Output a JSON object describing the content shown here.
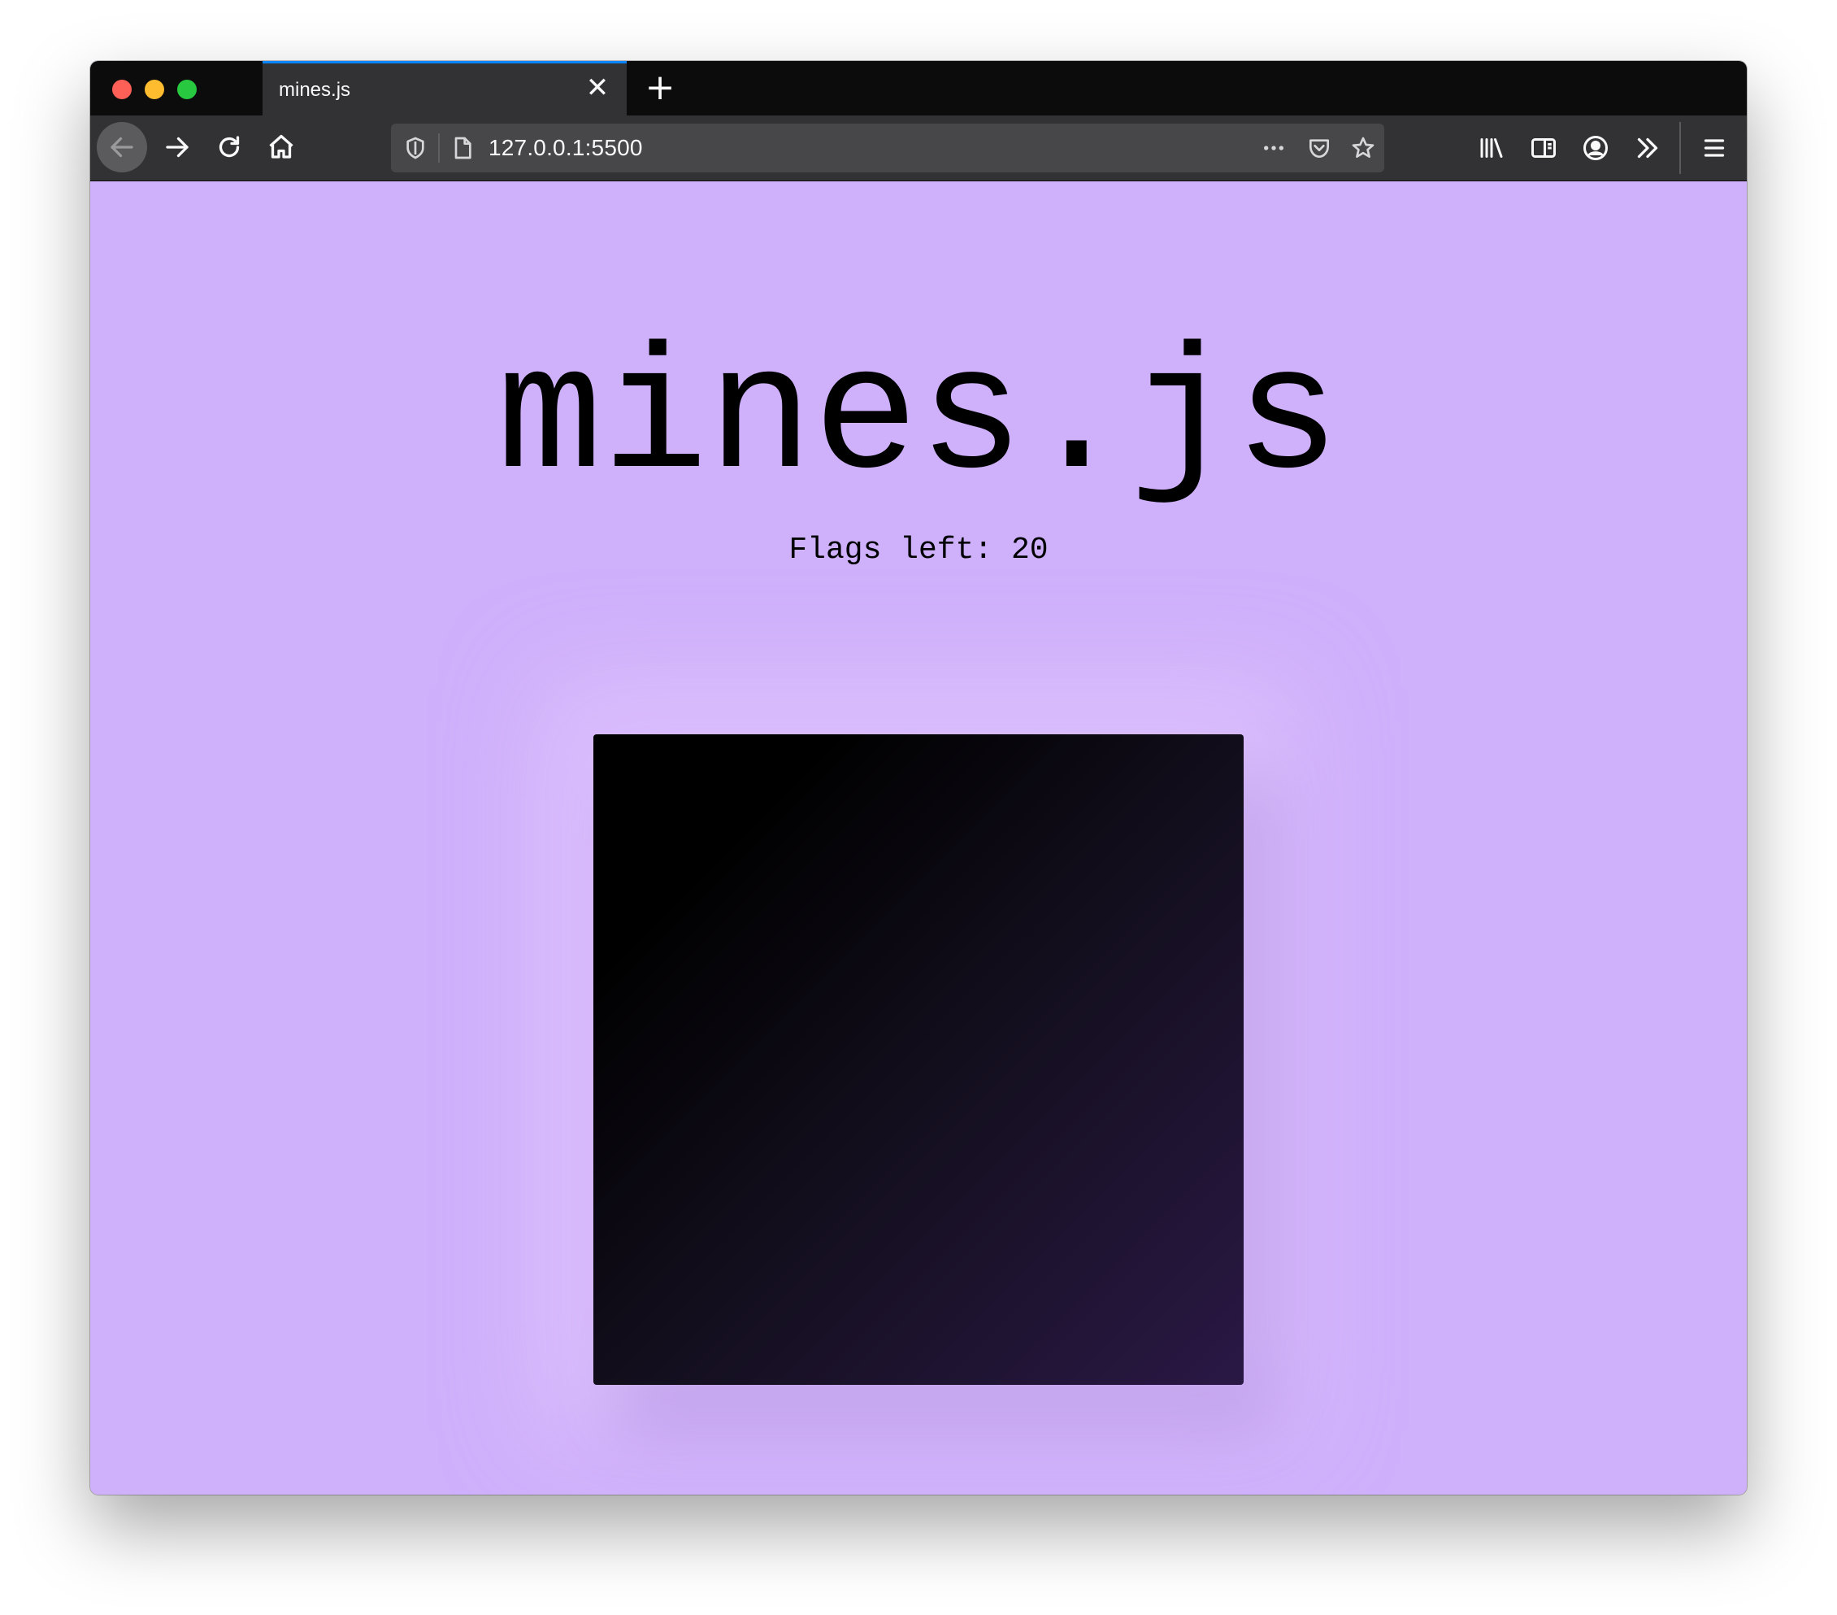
{
  "browser": {
    "tab_title": "mines.js",
    "tab_close_glyph": "✕",
    "new_tab_glyph": "+",
    "url": "127.0.0.1:5500",
    "accent": "#0a84ff",
    "icons": {
      "back": "arrow-left-icon",
      "forward": "arrow-right-icon",
      "reload": "reload-icon",
      "home": "home-icon",
      "shield": "shield-icon",
      "page": "page-icon",
      "more": "more-icon",
      "pocket": "pocket-icon",
      "bookmark": "star-icon",
      "library": "library-icon",
      "sidebar": "sidebar-icon",
      "account": "account-icon",
      "overflow": "chevrons-right-icon",
      "menu": "hamburger-menu-icon"
    }
  },
  "page": {
    "background": "#cfb0fb",
    "title": "mines.js",
    "flags_label": "Flags left: 20",
    "board_colors": [
      "#000000",
      "#2a1845"
    ]
  }
}
